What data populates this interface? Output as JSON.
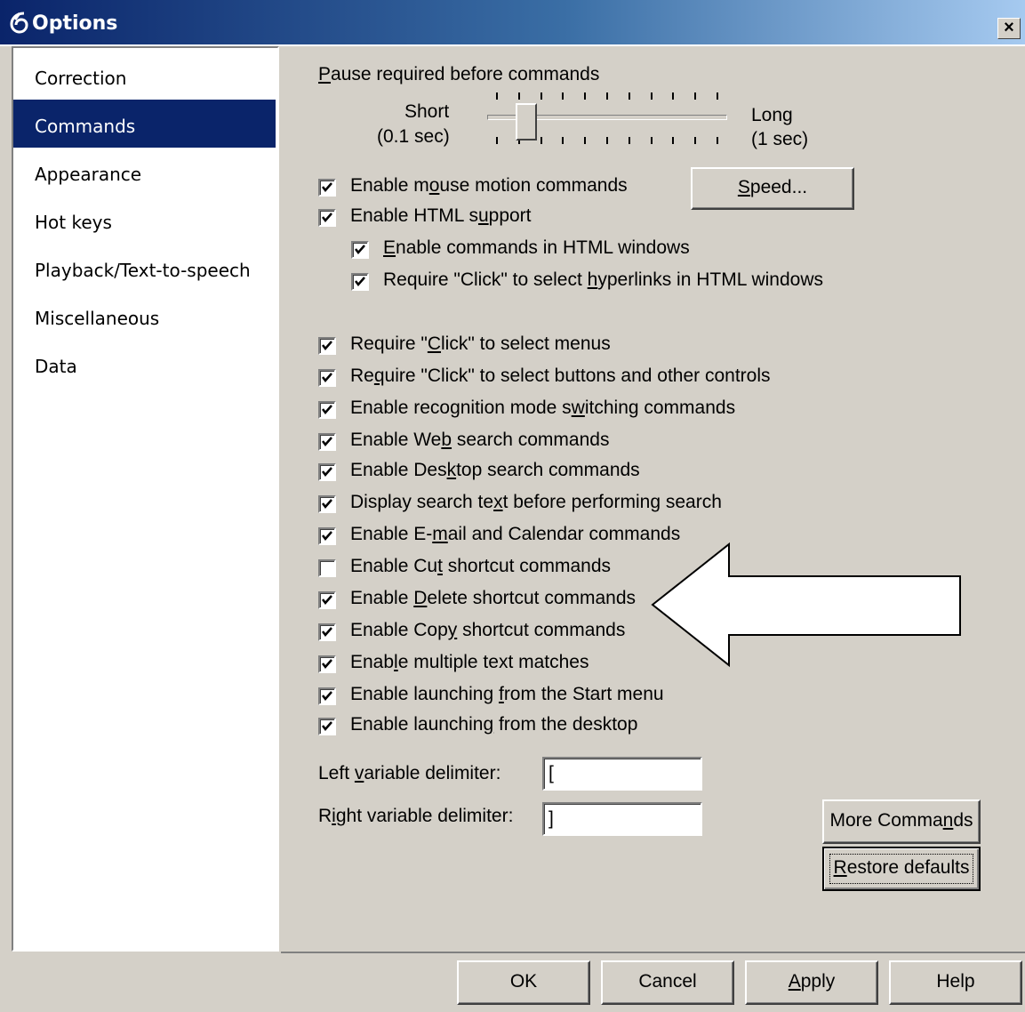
{
  "window": {
    "title": "Options",
    "app_icon": "speech-app-icon",
    "close_glyph": "×"
  },
  "nav": {
    "items": [
      {
        "label": "Correction",
        "selected": false
      },
      {
        "label": "Commands",
        "selected": true
      },
      {
        "label": "Appearance",
        "selected": false
      },
      {
        "label": "Hot keys",
        "selected": false
      },
      {
        "label": "Playback/Text-to-speech",
        "selected": false
      },
      {
        "label": "Miscellaneous",
        "selected": false
      },
      {
        "label": "Data",
        "selected": false
      }
    ]
  },
  "pause": {
    "label_pre": "",
    "label_u": "P",
    "label_post": "ause required before commands",
    "short_label": "Short",
    "short_sub": "(0.1 sec)",
    "long_label": "Long",
    "long_sub": "(1 sec)",
    "slider_position": 0.13
  },
  "speed_button": {
    "pre": "",
    "u": "S",
    "post": "peed..."
  },
  "checkboxes": [
    {
      "pre": "Enable m",
      "u": "o",
      "post": "use motion commands",
      "checked": true
    },
    {
      "pre": "Enable HTML s",
      "u": "u",
      "post": "pport",
      "checked": true
    },
    {
      "pre": "",
      "u": "E",
      "post": "nable commands in HTML windows",
      "checked": true
    },
    {
      "pre": "Require \"Click\" to select ",
      "u": "h",
      "post": "yperlinks in HTML windows",
      "checked": true
    },
    {
      "pre": "Require \"",
      "u": "C",
      "post": "lick\" to select menus",
      "checked": true
    },
    {
      "pre": "Re",
      "u": "q",
      "post": "uire \"Click\" to select buttons and other controls",
      "checked": true
    },
    {
      "pre": "Enable recognition mode s",
      "u": "w",
      "post": "itching commands",
      "checked": true
    },
    {
      "pre": "Enable We",
      "u": "b",
      "post": " search commands",
      "checked": true
    },
    {
      "pre": "Enable Des",
      "u": "k",
      "post": "top search commands",
      "checked": true
    },
    {
      "pre": "Display search te",
      "u": "x",
      "post": "t before performing search",
      "checked": true
    },
    {
      "pre": "Enable E-",
      "u": "m",
      "post": "ail and Calendar commands",
      "checked": true
    },
    {
      "pre": "Enable Cu",
      "u": "t",
      "post": " shortcut commands",
      "checked": false
    },
    {
      "pre": "Enable ",
      "u": "D",
      "post": "elete shortcut commands",
      "checked": true
    },
    {
      "pre": "Enable Cop",
      "u": "y",
      "post": " shortcut commands",
      "checked": true
    },
    {
      "pre": "Enab",
      "u": "l",
      "post": "e multiple text matches",
      "checked": true
    },
    {
      "pre": "Enable launching ",
      "u": "f",
      "post": "rom the Start menu",
      "checked": true
    },
    {
      "pre": "Enable launchin",
      "u": "g",
      "post": " from the desktop",
      "checked": true
    }
  ],
  "delimiters": {
    "left_pre": "Left ",
    "left_u": "v",
    "left_post": "ariable delimiter:",
    "left_value": "[",
    "right_pre": "R",
    "right_u": "i",
    "right_post": "ght variable delimiter:",
    "right_value": "]"
  },
  "more_commands": {
    "pre": "More Comma",
    "u": "n",
    "post": "ds"
  },
  "restore_defaults": {
    "pre": "",
    "u": "R",
    "post": "estore defaults"
  },
  "footer": {
    "ok": "OK",
    "cancel": "Cancel",
    "apply_pre": "",
    "apply_u": "A",
    "apply_post": "pply",
    "help": "Help"
  },
  "annotation": {
    "icon": "left-arrow-icon",
    "color": "#ffffff"
  }
}
